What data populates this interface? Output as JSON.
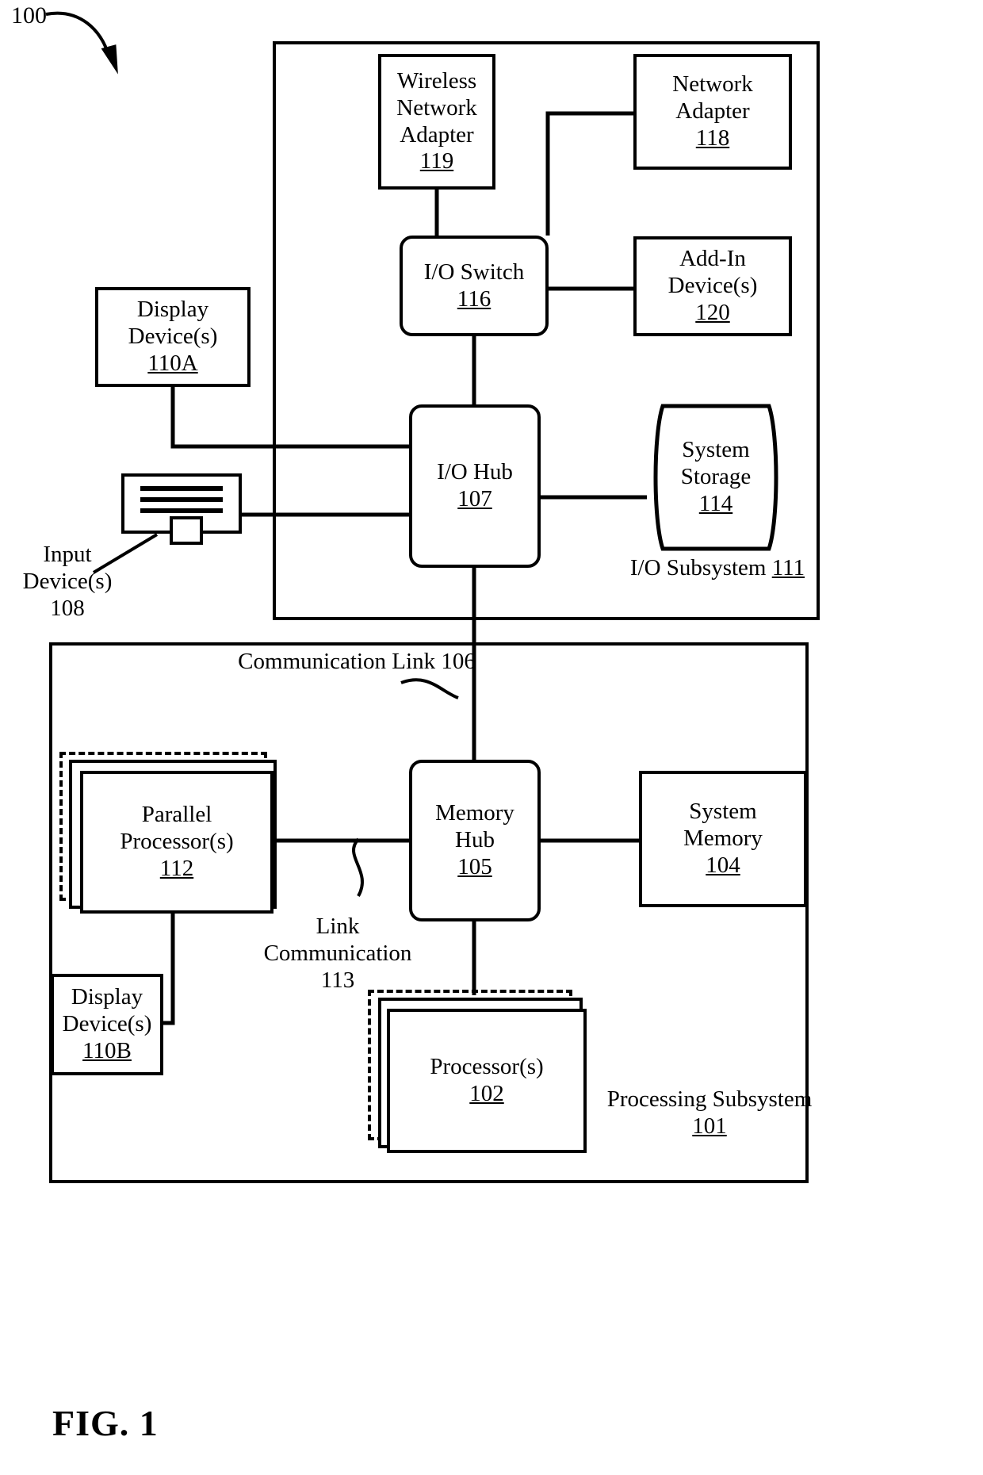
{
  "figure": {
    "number_tag": "100",
    "caption": "FIG. 1"
  },
  "io_subsystem": {
    "label_line1": "I/O Subsystem",
    "label_ref": "111"
  },
  "processing_subsystem": {
    "label_line1": "Processing Subsystem",
    "label_ref": "101"
  },
  "blocks": {
    "wireless_network_adapter": {
      "l1": "Wireless",
      "l2": "Network",
      "l3": "Adapter",
      "ref": "119"
    },
    "network_adapter": {
      "l1": "Network",
      "l2": "Adapter",
      "ref": "118"
    },
    "io_switch": {
      "l1": "I/O Switch",
      "ref": "116"
    },
    "add_in_devices": {
      "l1": "Add-In",
      "l2": "Device(s)",
      "ref": "120"
    },
    "display_device_a": {
      "l1": "Display",
      "l2": "Device(s)",
      "ref": "110A"
    },
    "io_hub": {
      "l1": "I/O Hub",
      "ref": "107"
    },
    "system_storage": {
      "l1": "System",
      "l2": "Storage",
      "ref": "114"
    },
    "parallel_processors": {
      "l1": "Parallel Processor(s)",
      "ref": "112"
    },
    "memory_hub": {
      "l1": "Memory",
      "l2": "Hub",
      "ref": "105"
    },
    "system_memory": {
      "l1": "System",
      "l2": "Memory",
      "ref": "104"
    },
    "processors": {
      "l1": "Processor(s)",
      "ref": "102"
    },
    "display_device_b": {
      "l1": "Display",
      "l2": "Device(s)",
      "ref": "110B"
    }
  },
  "callouts": {
    "input_devices": {
      "l1": "Input",
      "l2": "Device(s)",
      "ref": "108"
    },
    "communication_link_106": {
      "l1": "Communication",
      "l2": "Link",
      "ref": "106"
    },
    "link_communication_113": {
      "l1": "Link",
      "l2": "Communication",
      "ref": "113"
    }
  },
  "icons": {
    "input_device": "keyboard-icon",
    "figure_leader": "curved-arrow-icon"
  },
  "colors": {
    "stroke": "#000000",
    "background": "#ffffff"
  }
}
